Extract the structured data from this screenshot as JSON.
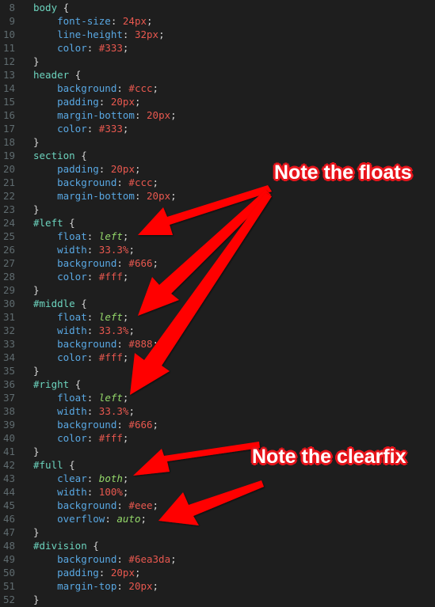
{
  "colors": {
    "background": "#1e1e1e",
    "line_number": "#5f6b6f",
    "selector": "#6cd3bd",
    "property": "#59a8e3",
    "value_number": "#e8584f",
    "keyword_value": "#94d86a",
    "punctuation": "#d4d4d4",
    "annotation_fill": "#ffffff",
    "annotation_outline": "#e8141b",
    "arrow": "#ff0000"
  },
  "lines": [
    {
      "n": "8",
      "tokens": [
        {
          "t": "body ",
          "c": "sel"
        },
        {
          "t": "{",
          "c": "punc"
        }
      ]
    },
    {
      "n": "9",
      "tokens": [
        {
          "t": "    font-size",
          "c": "prop"
        },
        {
          "t": ": ",
          "c": "punc"
        },
        {
          "t": "24",
          "c": "num"
        },
        {
          "t": "px",
          "c": "unit"
        },
        {
          "t": ";",
          "c": "punc"
        }
      ]
    },
    {
      "n": "10",
      "tokens": [
        {
          "t": "    line-height",
          "c": "prop"
        },
        {
          "t": ": ",
          "c": "punc"
        },
        {
          "t": "32",
          "c": "num"
        },
        {
          "t": "px",
          "c": "unit"
        },
        {
          "t": ";",
          "c": "punc"
        }
      ]
    },
    {
      "n": "11",
      "tokens": [
        {
          "t": "    color",
          "c": "prop"
        },
        {
          "t": ": ",
          "c": "punc"
        },
        {
          "t": "#333",
          "c": "col"
        },
        {
          "t": ";",
          "c": "punc"
        }
      ]
    },
    {
      "n": "12",
      "tokens": [
        {
          "t": "}",
          "c": "punc"
        }
      ]
    },
    {
      "n": "13",
      "tokens": [
        {
          "t": "header ",
          "c": "sel"
        },
        {
          "t": "{",
          "c": "punc"
        }
      ]
    },
    {
      "n": "14",
      "tokens": [
        {
          "t": "    background",
          "c": "prop"
        },
        {
          "t": ": ",
          "c": "punc"
        },
        {
          "t": "#ccc",
          "c": "col"
        },
        {
          "t": ";",
          "c": "punc"
        }
      ]
    },
    {
      "n": "15",
      "tokens": [
        {
          "t": "    padding",
          "c": "prop"
        },
        {
          "t": ": ",
          "c": "punc"
        },
        {
          "t": "20",
          "c": "num"
        },
        {
          "t": "px",
          "c": "unit"
        },
        {
          "t": ";",
          "c": "punc"
        }
      ]
    },
    {
      "n": "16",
      "tokens": [
        {
          "t": "    margin-bottom",
          "c": "prop"
        },
        {
          "t": ": ",
          "c": "punc"
        },
        {
          "t": "20",
          "c": "num"
        },
        {
          "t": "px",
          "c": "unit"
        },
        {
          "t": ";",
          "c": "punc"
        }
      ]
    },
    {
      "n": "17",
      "tokens": [
        {
          "t": "    color",
          "c": "prop"
        },
        {
          "t": ": ",
          "c": "punc"
        },
        {
          "t": "#333",
          "c": "col"
        },
        {
          "t": ";",
          "c": "punc"
        }
      ]
    },
    {
      "n": "18",
      "tokens": [
        {
          "t": "}",
          "c": "punc"
        }
      ]
    },
    {
      "n": "19",
      "tokens": [
        {
          "t": "section ",
          "c": "sel"
        },
        {
          "t": "{",
          "c": "punc"
        }
      ]
    },
    {
      "n": "20",
      "tokens": [
        {
          "t": "    padding",
          "c": "prop"
        },
        {
          "t": ": ",
          "c": "punc"
        },
        {
          "t": "20",
          "c": "num"
        },
        {
          "t": "px",
          "c": "unit"
        },
        {
          "t": ";",
          "c": "punc"
        }
      ]
    },
    {
      "n": "21",
      "tokens": [
        {
          "t": "    background",
          "c": "prop"
        },
        {
          "t": ": ",
          "c": "punc"
        },
        {
          "t": "#ccc",
          "c": "col"
        },
        {
          "t": ";",
          "c": "punc"
        }
      ]
    },
    {
      "n": "22",
      "tokens": [
        {
          "t": "    margin-bottom",
          "c": "prop"
        },
        {
          "t": ": ",
          "c": "punc"
        },
        {
          "t": "20",
          "c": "num"
        },
        {
          "t": "px",
          "c": "unit"
        },
        {
          "t": ";",
          "c": "punc"
        }
      ]
    },
    {
      "n": "23",
      "tokens": [
        {
          "t": "}",
          "c": "punc"
        }
      ]
    },
    {
      "n": "24",
      "tokens": [
        {
          "t": "#left ",
          "c": "sel"
        },
        {
          "t": "{",
          "c": "punc"
        }
      ]
    },
    {
      "n": "25",
      "tokens": [
        {
          "t": "    float",
          "c": "prop"
        },
        {
          "t": ": ",
          "c": "punc"
        },
        {
          "t": "left",
          "c": "kw"
        },
        {
          "t": ";",
          "c": "punc"
        }
      ]
    },
    {
      "n": "26",
      "tokens": [
        {
          "t": "    width",
          "c": "prop"
        },
        {
          "t": ": ",
          "c": "punc"
        },
        {
          "t": "33.3",
          "c": "num"
        },
        {
          "t": "%",
          "c": "unit"
        },
        {
          "t": ";",
          "c": "punc"
        }
      ]
    },
    {
      "n": "27",
      "tokens": [
        {
          "t": "    background",
          "c": "prop"
        },
        {
          "t": ": ",
          "c": "punc"
        },
        {
          "t": "#666",
          "c": "col"
        },
        {
          "t": ";",
          "c": "punc"
        }
      ]
    },
    {
      "n": "28",
      "tokens": [
        {
          "t": "    color",
          "c": "prop"
        },
        {
          "t": ": ",
          "c": "punc"
        },
        {
          "t": "#fff",
          "c": "col"
        },
        {
          "t": ";",
          "c": "punc"
        }
      ]
    },
    {
      "n": "29",
      "tokens": [
        {
          "t": "}",
          "c": "punc"
        }
      ]
    },
    {
      "n": "30",
      "tokens": [
        {
          "t": "#middle ",
          "c": "sel"
        },
        {
          "t": "{",
          "c": "punc"
        }
      ]
    },
    {
      "n": "31",
      "tokens": [
        {
          "t": "    float",
          "c": "prop"
        },
        {
          "t": ": ",
          "c": "punc"
        },
        {
          "t": "left",
          "c": "kw"
        },
        {
          "t": ";",
          "c": "punc"
        }
      ]
    },
    {
      "n": "32",
      "tokens": [
        {
          "t": "    width",
          "c": "prop"
        },
        {
          "t": ": ",
          "c": "punc"
        },
        {
          "t": "33.3",
          "c": "num"
        },
        {
          "t": "%",
          "c": "unit"
        },
        {
          "t": ";",
          "c": "punc"
        }
      ]
    },
    {
      "n": "33",
      "tokens": [
        {
          "t": "    background",
          "c": "prop"
        },
        {
          "t": ": ",
          "c": "punc"
        },
        {
          "t": "#888",
          "c": "col"
        },
        {
          "t": ";",
          "c": "punc"
        }
      ]
    },
    {
      "n": "34",
      "tokens": [
        {
          "t": "    color",
          "c": "prop"
        },
        {
          "t": ": ",
          "c": "punc"
        },
        {
          "t": "#fff",
          "c": "col"
        },
        {
          "t": ";",
          "c": "punc"
        }
      ]
    },
    {
      "n": "35",
      "tokens": [
        {
          "t": "}",
          "c": "punc"
        }
      ]
    },
    {
      "n": "36",
      "tokens": [
        {
          "t": "#right ",
          "c": "sel"
        },
        {
          "t": "{",
          "c": "punc"
        }
      ]
    },
    {
      "n": "37",
      "tokens": [
        {
          "t": "    float",
          "c": "prop"
        },
        {
          "t": ": ",
          "c": "punc"
        },
        {
          "t": "left",
          "c": "kw"
        },
        {
          "t": ";",
          "c": "punc"
        }
      ]
    },
    {
      "n": "38",
      "tokens": [
        {
          "t": "    width",
          "c": "prop"
        },
        {
          "t": ": ",
          "c": "punc"
        },
        {
          "t": "33.3",
          "c": "num"
        },
        {
          "t": "%",
          "c": "unit"
        },
        {
          "t": ";",
          "c": "punc"
        }
      ]
    },
    {
      "n": "39",
      "tokens": [
        {
          "t": "    background",
          "c": "prop"
        },
        {
          "t": ": ",
          "c": "punc"
        },
        {
          "t": "#666",
          "c": "col"
        },
        {
          "t": ";",
          "c": "punc"
        }
      ]
    },
    {
      "n": "40",
      "tokens": [
        {
          "t": "    color",
          "c": "prop"
        },
        {
          "t": ": ",
          "c": "punc"
        },
        {
          "t": "#fff",
          "c": "col"
        },
        {
          "t": ";",
          "c": "punc"
        }
      ]
    },
    {
      "n": "41",
      "tokens": [
        {
          "t": "}",
          "c": "punc"
        }
      ]
    },
    {
      "n": "42",
      "tokens": [
        {
          "t": "#full ",
          "c": "sel"
        },
        {
          "t": "{",
          "c": "punc"
        }
      ]
    },
    {
      "n": "43",
      "tokens": [
        {
          "t": "    clear",
          "c": "prop"
        },
        {
          "t": ": ",
          "c": "punc"
        },
        {
          "t": "both",
          "c": "kw"
        },
        {
          "t": ";",
          "c": "punc"
        }
      ]
    },
    {
      "n": "44",
      "tokens": [
        {
          "t": "    width",
          "c": "prop"
        },
        {
          "t": ": ",
          "c": "punc"
        },
        {
          "t": "100",
          "c": "num"
        },
        {
          "t": "%",
          "c": "unit"
        },
        {
          "t": ";",
          "c": "punc"
        }
      ]
    },
    {
      "n": "45",
      "tokens": [
        {
          "t": "    background",
          "c": "prop"
        },
        {
          "t": ": ",
          "c": "punc"
        },
        {
          "t": "#eee",
          "c": "col"
        },
        {
          "t": ";",
          "c": "punc"
        }
      ]
    },
    {
      "n": "46",
      "tokens": [
        {
          "t": "    overflow",
          "c": "prop"
        },
        {
          "t": ": ",
          "c": "punc"
        },
        {
          "t": "auto",
          "c": "kw"
        },
        {
          "t": ";",
          "c": "punc"
        }
      ]
    },
    {
      "n": "47",
      "tokens": [
        {
          "t": "}",
          "c": "punc"
        }
      ]
    },
    {
      "n": "48",
      "tokens": [
        {
          "t": "#division ",
          "c": "sel"
        },
        {
          "t": "{",
          "c": "punc"
        }
      ]
    },
    {
      "n": "49",
      "tokens": [
        {
          "t": "    background",
          "c": "prop"
        },
        {
          "t": ": ",
          "c": "punc"
        },
        {
          "t": "#6ea3da",
          "c": "col"
        },
        {
          "t": ";",
          "c": "punc"
        }
      ]
    },
    {
      "n": "50",
      "tokens": [
        {
          "t": "    padding",
          "c": "prop"
        },
        {
          "t": ": ",
          "c": "punc"
        },
        {
          "t": "20",
          "c": "num"
        },
        {
          "t": "px",
          "c": "unit"
        },
        {
          "t": ";",
          "c": "punc"
        }
      ]
    },
    {
      "n": "51",
      "tokens": [
        {
          "t": "    margin-top",
          "c": "prop"
        },
        {
          "t": ": ",
          "c": "punc"
        },
        {
          "t": "20",
          "c": "num"
        },
        {
          "t": "px",
          "c": "unit"
        },
        {
          "t": ";",
          "c": "punc"
        }
      ]
    },
    {
      "n": "52",
      "tokens": [
        {
          "t": "}",
          "c": "punc"
        }
      ]
    }
  ],
  "annotations": {
    "floats": "Note the floats",
    "clearfix": "Note the clearfix"
  }
}
